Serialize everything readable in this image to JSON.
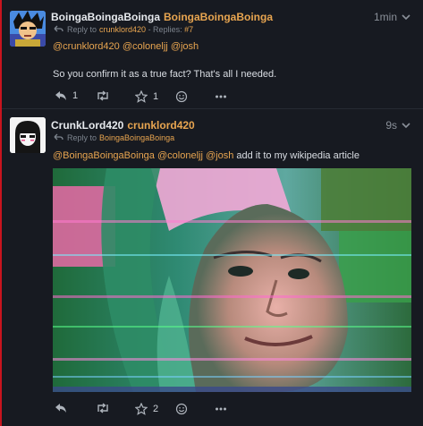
{
  "posts": [
    {
      "display_name": "BoingaBoingaBoinga",
      "handle": "BoingaBoingaBoinga",
      "time": "1min",
      "reply_prefix": "Reply to",
      "reply_to": "crunklord420",
      "replies_label": " - Replies: ",
      "replies_count": "#7",
      "mentions": [
        "@crunklord420",
        "@coloneljj",
        "@josh"
      ],
      "text": "So you confirm it as a true fact? That's all I needed.",
      "reply_count": "1",
      "like_count": "1"
    },
    {
      "display_name": "CrunkLord420",
      "handle": "crunklord420",
      "time": "9s",
      "reply_prefix": "Reply to",
      "reply_to": "BoingaBoingaBoinga",
      "mentions": [
        "@BoingaBoingaBoinga",
        "@coloneljj",
        "@josh"
      ],
      "text": " add it to my wikipedia article",
      "like_count": "2"
    }
  ],
  "colors": {
    "accent": "#e8a550",
    "background": "#13161c",
    "card": "#171a21",
    "left_bar": "#c8141e"
  },
  "icons": [
    "reply-icon",
    "retweet-icon",
    "star-icon",
    "emoji-icon",
    "more-icon",
    "chevron-down-icon"
  ]
}
